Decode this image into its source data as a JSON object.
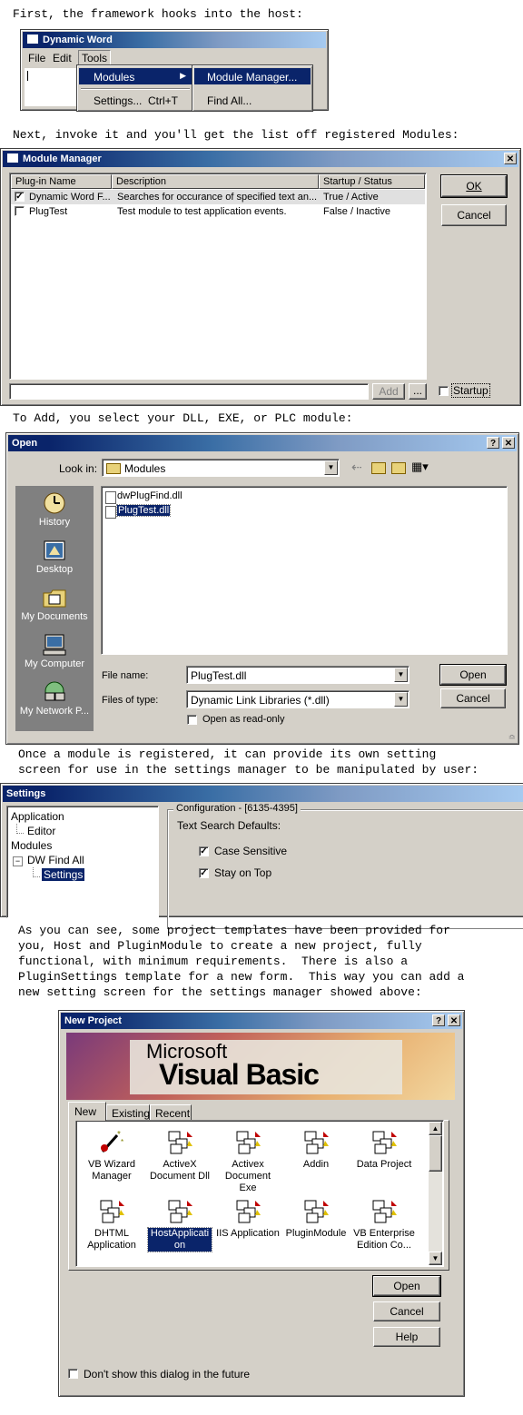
{
  "captions": {
    "c1": "First, the framework hooks into the host:",
    "c2": "Next, invoke it and you'll get the list off registered Modules:",
    "c3": "To Add, you select your DLL, EXE, or PLC module:",
    "c4a": "Once a module is registered, it can provide its own setting",
    "c4b": "screen for use in the settings manager to be manipulated by user:",
    "c5a": "As you can see, some project templates have been provided for",
    "c5b": "you, Host and PluginModule to create a new project, fully",
    "c5c": "functional, with minimum requirements.  There is also a",
    "c5d": "PluginSettings template for a new form.  This way you can add a",
    "c5e": "new setting screen for the settings manager showed above:"
  },
  "dynamic_word": {
    "title": "Dynamic Word",
    "menu": [
      "File",
      "Edit",
      "Tools"
    ],
    "tools_menu": {
      "modules": "Modules",
      "settings": "Settings...",
      "settings_shortcut": "Ctrl+T"
    },
    "sub_menu": {
      "module_manager": "Module Manager...",
      "find_all": "Find All..."
    }
  },
  "module_manager": {
    "title": "Module Manager",
    "columns": [
      "Plug-in Name",
      "Description",
      "Startup / Status"
    ],
    "rows": [
      {
        "checked": true,
        "name": "Dynamic Word F...",
        "description": "Searches for occurance of specified text an...",
        "status": "True / Active"
      },
      {
        "checked": false,
        "name": "PlugTest",
        "description": "Test module to test application events.",
        "status": "False / Inactive"
      }
    ],
    "ok": "OK",
    "cancel": "Cancel",
    "add": "Add",
    "browse": "...",
    "startup": "Startup"
  },
  "open_dialog": {
    "title": "Open",
    "look_in_label": "Look in:",
    "look_in_value": "Modules",
    "places": [
      "History",
      "Desktop",
      "My Documents",
      "My Computer",
      "My Network P..."
    ],
    "files": [
      "dwPlugFind.dll",
      "PlugTest.dll"
    ],
    "file_name_label": "File name:",
    "file_name_value": "PlugTest.dll",
    "files_of_type_label": "Files of type:",
    "files_of_type_value": "Dynamic Link Libraries (*.dll)",
    "read_only": "Open as read-only",
    "open": "Open",
    "cancel": "Cancel"
  },
  "settings": {
    "title": "Settings",
    "tree": [
      "Application",
      "Editor",
      "Modules",
      "DW Find All",
      "Settings"
    ],
    "group_title": "Configuration - [6135-4395]",
    "heading": "Text Search Defaults:",
    "case_sensitive": "Case Sensitive",
    "stay_on_top": "Stay on Top"
  },
  "new_project": {
    "title": "New Project",
    "banner_top": "Microsoft",
    "banner_main": "Visual Basic",
    "tabs": [
      "New",
      "Existing",
      "Recent"
    ],
    "icons": [
      "VB Wizard Manager",
      "ActiveX Document Dll",
      "Activex Document Exe",
      "Addin",
      "Data Project",
      "DHTML Application",
      "HostApplication",
      "IIS Application",
      "PluginModule",
      "VB Enterprise Edition Co..."
    ],
    "open": "Open",
    "cancel": "Cancel",
    "help": "Help",
    "dont_show": "Don't show this dialog in the future"
  }
}
